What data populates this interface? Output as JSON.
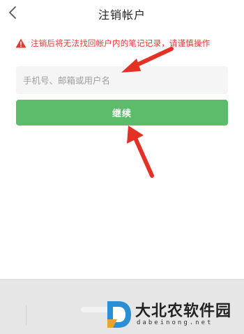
{
  "header": {
    "title": "注销帐户",
    "back_icon": "chevron-left-icon"
  },
  "warning": {
    "icon": "warning-triangle-icon",
    "text": "注销后将无法找回帐户内的笔记记录，请谨慎操作",
    "color": "#e53935"
  },
  "form": {
    "account_placeholder": "手机号、邮箱或用户名",
    "account_value": ""
  },
  "actions": {
    "continue_label": "继续",
    "accent_color": "#5dbb6c"
  },
  "annotations": {
    "arrow_color": "#e53125"
  },
  "watermark": {
    "title": "大北农软件园",
    "url": "dabeinong.net"
  }
}
